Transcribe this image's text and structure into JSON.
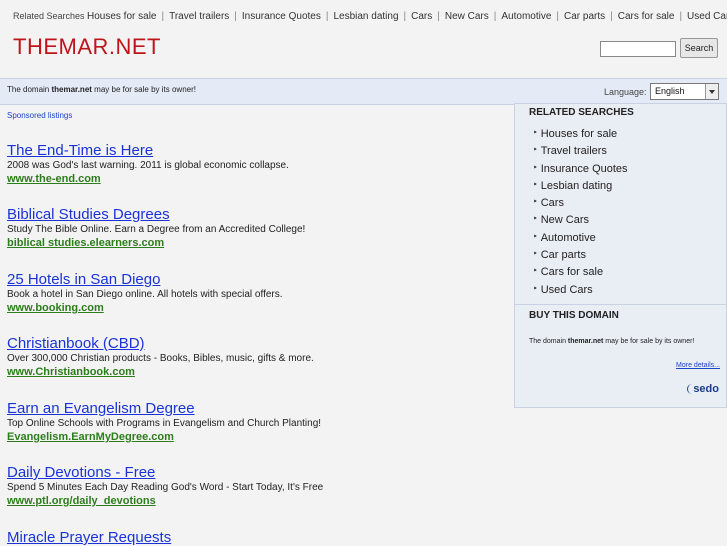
{
  "top_nav": {
    "label": "Related Searches",
    "links": [
      "Houses for sale",
      "Travel trailers",
      "Insurance Quotes",
      "Lesbian dating",
      "Cars",
      "New Cars",
      "Automotive",
      "Car parts",
      "Cars for sale",
      "Used Cars"
    ]
  },
  "header": {
    "logo": "THEMAR.NET",
    "search_value": "",
    "search_button": "Search"
  },
  "notice_bar": {
    "prefix": "The domain ",
    "domain": "themar.net",
    "suffix": " may be for sale by its owner!",
    "language_label": "Language:",
    "language_value": "English"
  },
  "sponsored": {
    "label": "Sponsored listings",
    "ads": [
      {
        "title": "The End-Time is Here",
        "desc": "2008 was God's last warning. 2011 is global economic collapse.",
        "url": "www.the-end.com"
      },
      {
        "title": "Biblical Studies Degrees",
        "desc": "Study The Bible Online. Earn a Degree from an Accredited College!",
        "url": "biblical studies.elearners.com"
      },
      {
        "title": "25 Hotels in San Diego",
        "desc": "Book a hotel in San Diego online. All hotels with special offers.",
        "url": "www.booking.com"
      },
      {
        "title": "Christianbook (CBD)",
        "desc": "Over 300,000 Christian products - Books, Bibles, music, gifts & more.",
        "url": "www.Christianbook.com"
      },
      {
        "title": "Earn an Evangelism Degree",
        "desc": "Top Online Schools with Programs in Evangelism and Church Planting!",
        "url": "Evangelism.EarnMyDegree.com"
      },
      {
        "title": "Daily Devotions - Free",
        "desc": "Spend 5 Minutes Each Day Reading God's Word - Start Today, It's Free",
        "url": "www.ptl.org/daily_devotions"
      },
      {
        "title": "Miracle Prayer Requests",
        "desc": "",
        "url": ""
      }
    ]
  },
  "sidebar": {
    "related_title": "RELATED SEARCHES",
    "items": [
      "Houses for sale",
      "Travel trailers",
      "Insurance Quotes",
      "Lesbian dating",
      "Cars",
      "New Cars",
      "Automotive",
      "Car parts",
      "Cars for sale",
      "Used Cars"
    ],
    "buy_title": "BUY THIS DOMAIN",
    "buy_prefix": "The domain ",
    "buy_domain": "themar.net",
    "buy_suffix": " may be for sale by its owner!",
    "more_details": "More details...",
    "sedo_logo": "sedo"
  }
}
